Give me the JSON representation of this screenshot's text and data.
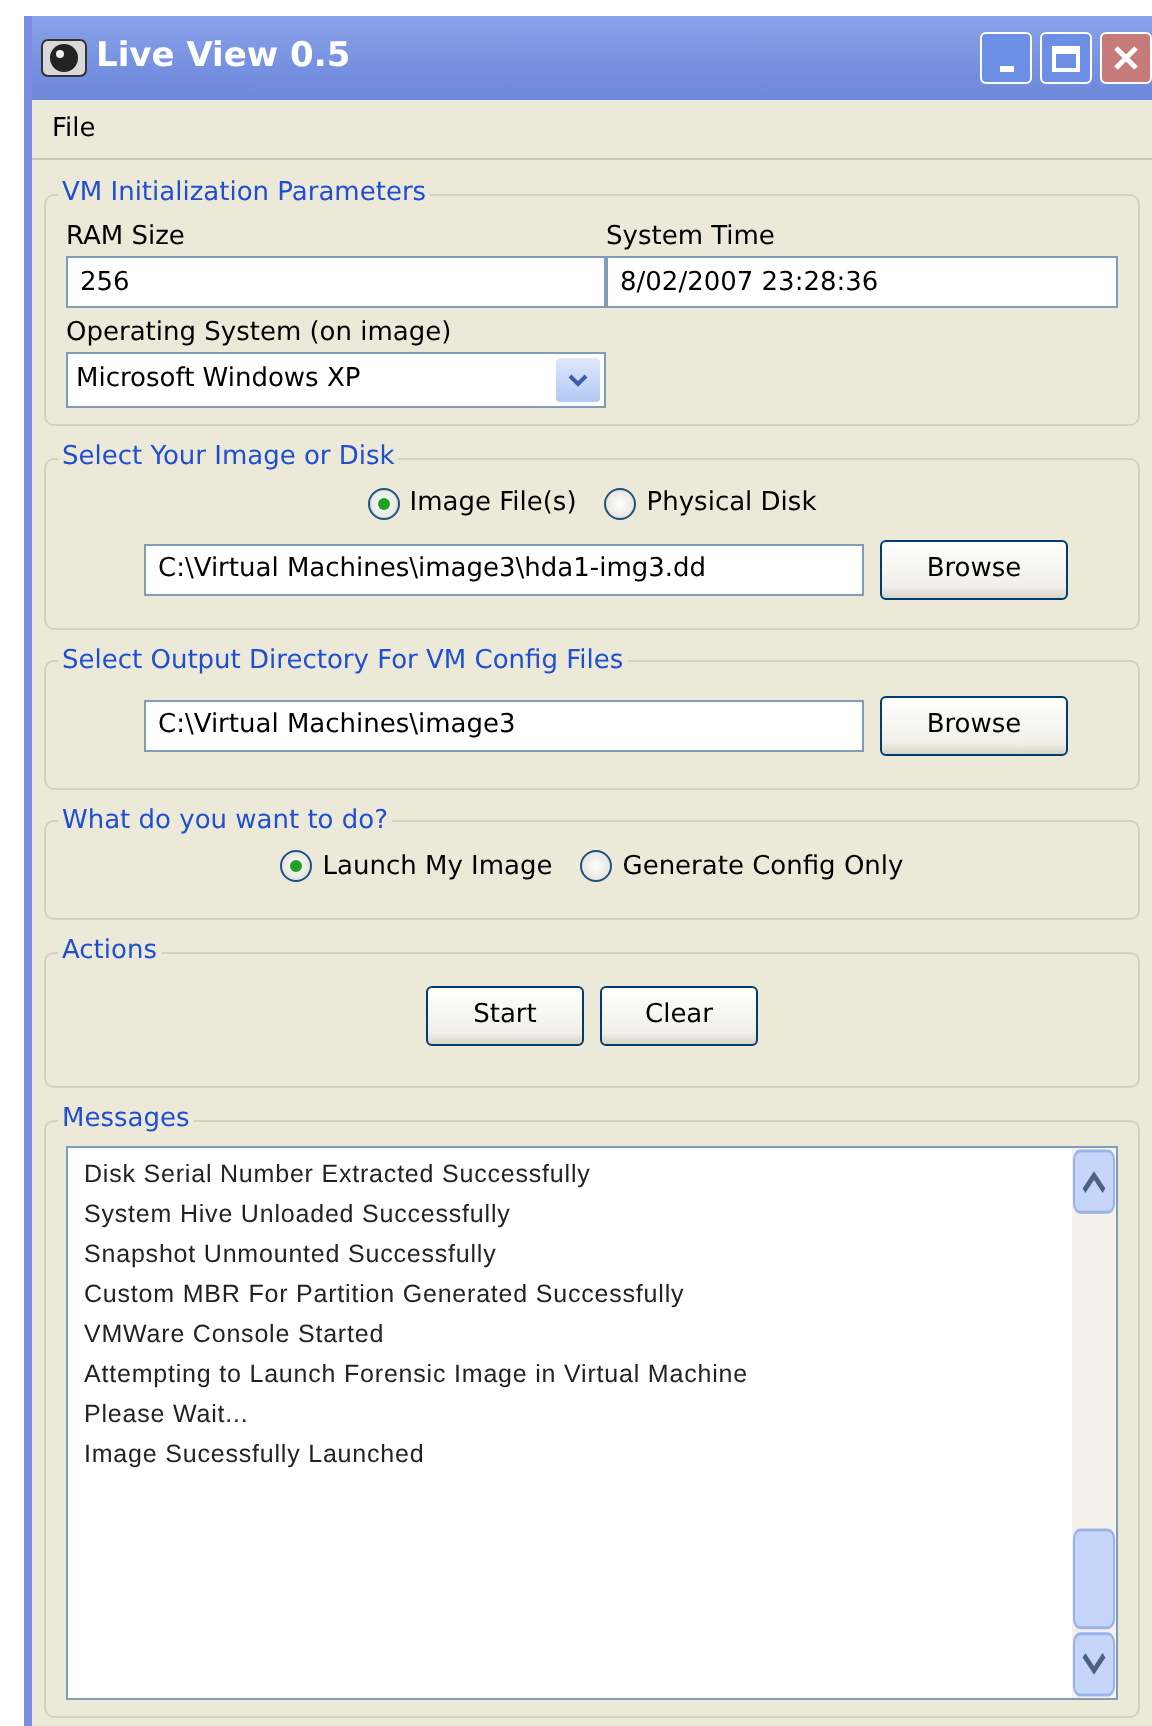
{
  "window": {
    "title": "Live View 0.5"
  },
  "menu": [
    "File"
  ],
  "vm_parameters": {
    "title": "VM Initialization Parameters",
    "ram_label": "RAM Size",
    "ram_value": "256",
    "time_label": "System Time",
    "time_value": "8/02/2007 23:28:36",
    "os_label": "Operating System (on image)",
    "os_value": "Microsoft Windows XP"
  },
  "image_source": {
    "title": "Select Your Image or Disk",
    "options": [
      {
        "label": "Image File(s)",
        "selected": true
      },
      {
        "label": "Physical Disk",
        "selected": false
      }
    ],
    "path": "C:\\Virtual Machines\\image3\\hda1-img3.dd",
    "button": "Browse"
  },
  "output_directory": {
    "title": "Select Output Directory For VM Config Files",
    "path": "C:\\Virtual Machines\\image3",
    "button": "Browse"
  },
  "task": {
    "title": "What do you want to do?",
    "options": [
      {
        "label": "Launch My Image",
        "selected": true
      },
      {
        "label": "Generate Config Only",
        "selected": false
      }
    ]
  },
  "actions": {
    "title": "Actions",
    "buttons": [
      "Start",
      "Clear"
    ]
  },
  "messages": {
    "title": "Messages",
    "lines": [
      "Disk Serial Number Extracted Successfully",
      "System Hive Unloaded Successfully",
      "Snapshot Unmounted Successfully",
      "Custom MBR For Partition Generated Successfully",
      "VMWare Console Started",
      "Attempting to Launch Forensic Image in Virtual Machine",
      "Please Wait...",
      "Image Sucessfully Launched"
    ]
  }
}
